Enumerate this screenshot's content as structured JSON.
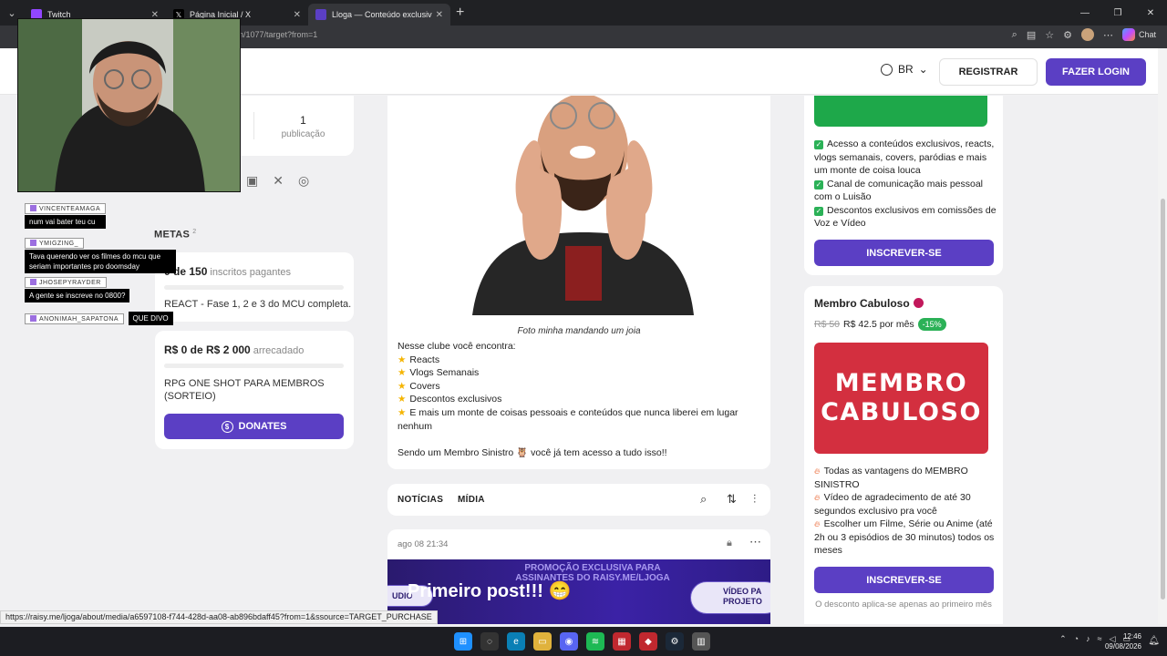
{
  "browser": {
    "tabs": [
      {
        "label": "Twitch",
        "favicon_color": "#9146ff",
        "active": false
      },
      {
        "label": "Página Inicial / X",
        "favicon_color": "#000000",
        "active": false
      },
      {
        "label": "Lloga — Conteúdo exclusivo no R",
        "favicon_color": "#5b3fc4",
        "active": true
      }
    ],
    "url": "n/1077/target?from=1",
    "chat_label": "Chat",
    "status_url": "https://raisy.me/ljoga/about/media/a6597108-f744-428d-aa08-ab896bdaff45?from=1&ssource=TARGET_PURCHASE"
  },
  "header": {
    "language": "BR",
    "register_label": "REGISTRAR",
    "login_label": "FAZER LOGIN"
  },
  "profile": {
    "publications_count": "1",
    "publications_label": "publicação"
  },
  "metas": {
    "title": "METAS",
    "count": "2",
    "goal1": {
      "amount": "0 de 150",
      "unit": "inscritos pagantes",
      "progress": 0,
      "description": "REACT - Fase 1, 2 e 3 do MCU completa."
    },
    "goal2": {
      "amount": "R$ 0 de R$ 2 000",
      "unit": "arrecadado",
      "progress": 0,
      "description": "RPG ONE SHOT PARA MEMBROS (SORTEIO)",
      "button_label": "DONATES"
    }
  },
  "post": {
    "caption": "Foto minha mandando um joia",
    "intro": "Nesse clube você encontra:",
    "items": [
      "Reacts",
      "Vlogs Semanais",
      "Covers",
      "Descontos exclusivos",
      "E mais um monte de coisas pessoais e conteúdos que nunca liberei em lugar nenhum"
    ],
    "closing": "Sendo um Membro Sinistro 🦉 você já tem acesso a tudo isso!!"
  },
  "feed": {
    "tab_news": "NOTÍCIAS",
    "tab_media": "MÍDIA",
    "item_date": "ago 08 21:34",
    "banner_promo": "PROMOÇÃO EXCLUSIVA PARA ASSINANTES DO RAISY.ME/LJOGA",
    "banner_title": "Primeiro post!!! 😁",
    "banner_pill_left": "UDIO",
    "banner_pill_right": "VÍDEO PA PROJETO"
  },
  "tier1": {
    "benefits": [
      "Acesso a conteúdos exclusivos, reacts, vlogs semanais, covers, paródias e mais um monte de coisa louca",
      "Canal de comunicação mais pessoal com o Luisão",
      "Descontos exclusivos em comissões de Voz e Vídeo"
    ],
    "button_label": "INSCREVER-SE"
  },
  "tier2": {
    "name": "Membro Cabuloso",
    "old_price": "R$ 50",
    "price": "R$ 42.5 por mês",
    "discount": "-15%",
    "image_line1": "MEMBRO",
    "image_line2": "CABULOSO",
    "benefits": [
      "Todas as vantagens do MEMBRO SINISTRO",
      "Vídeo de agradecimento de até 30 segundos exclusivo pra você",
      "Escolher um Filme, Série ou Anime (até 2h ou 3 episódios de 30 minutos) todos os meses"
    ],
    "button_label": "INSCREVER-SE",
    "note": "O desconto aplica-se apenas ao primeiro mês"
  },
  "stream_chat": [
    {
      "user": "VINCENTEAMAGA",
      "text": "num vai bater teu cu"
    },
    {
      "user": "YMIGZING_",
      "text": "Tava querendo ver os filmes do mcu que seriam importantes pro doomsday"
    },
    {
      "user": "JHOSEPYRAYDER",
      "text": "A gente se inscreve no 0800?"
    },
    {
      "user": "ANONIMAH_SAPATONA",
      "text": "QUE DIVO"
    }
  ],
  "taskbar": {
    "time": "12:46",
    "date": "09/08/2026"
  },
  "colors": {
    "accent": "#5b3fc4",
    "green": "#2bb157",
    "red_tier": "#d32f3f"
  }
}
